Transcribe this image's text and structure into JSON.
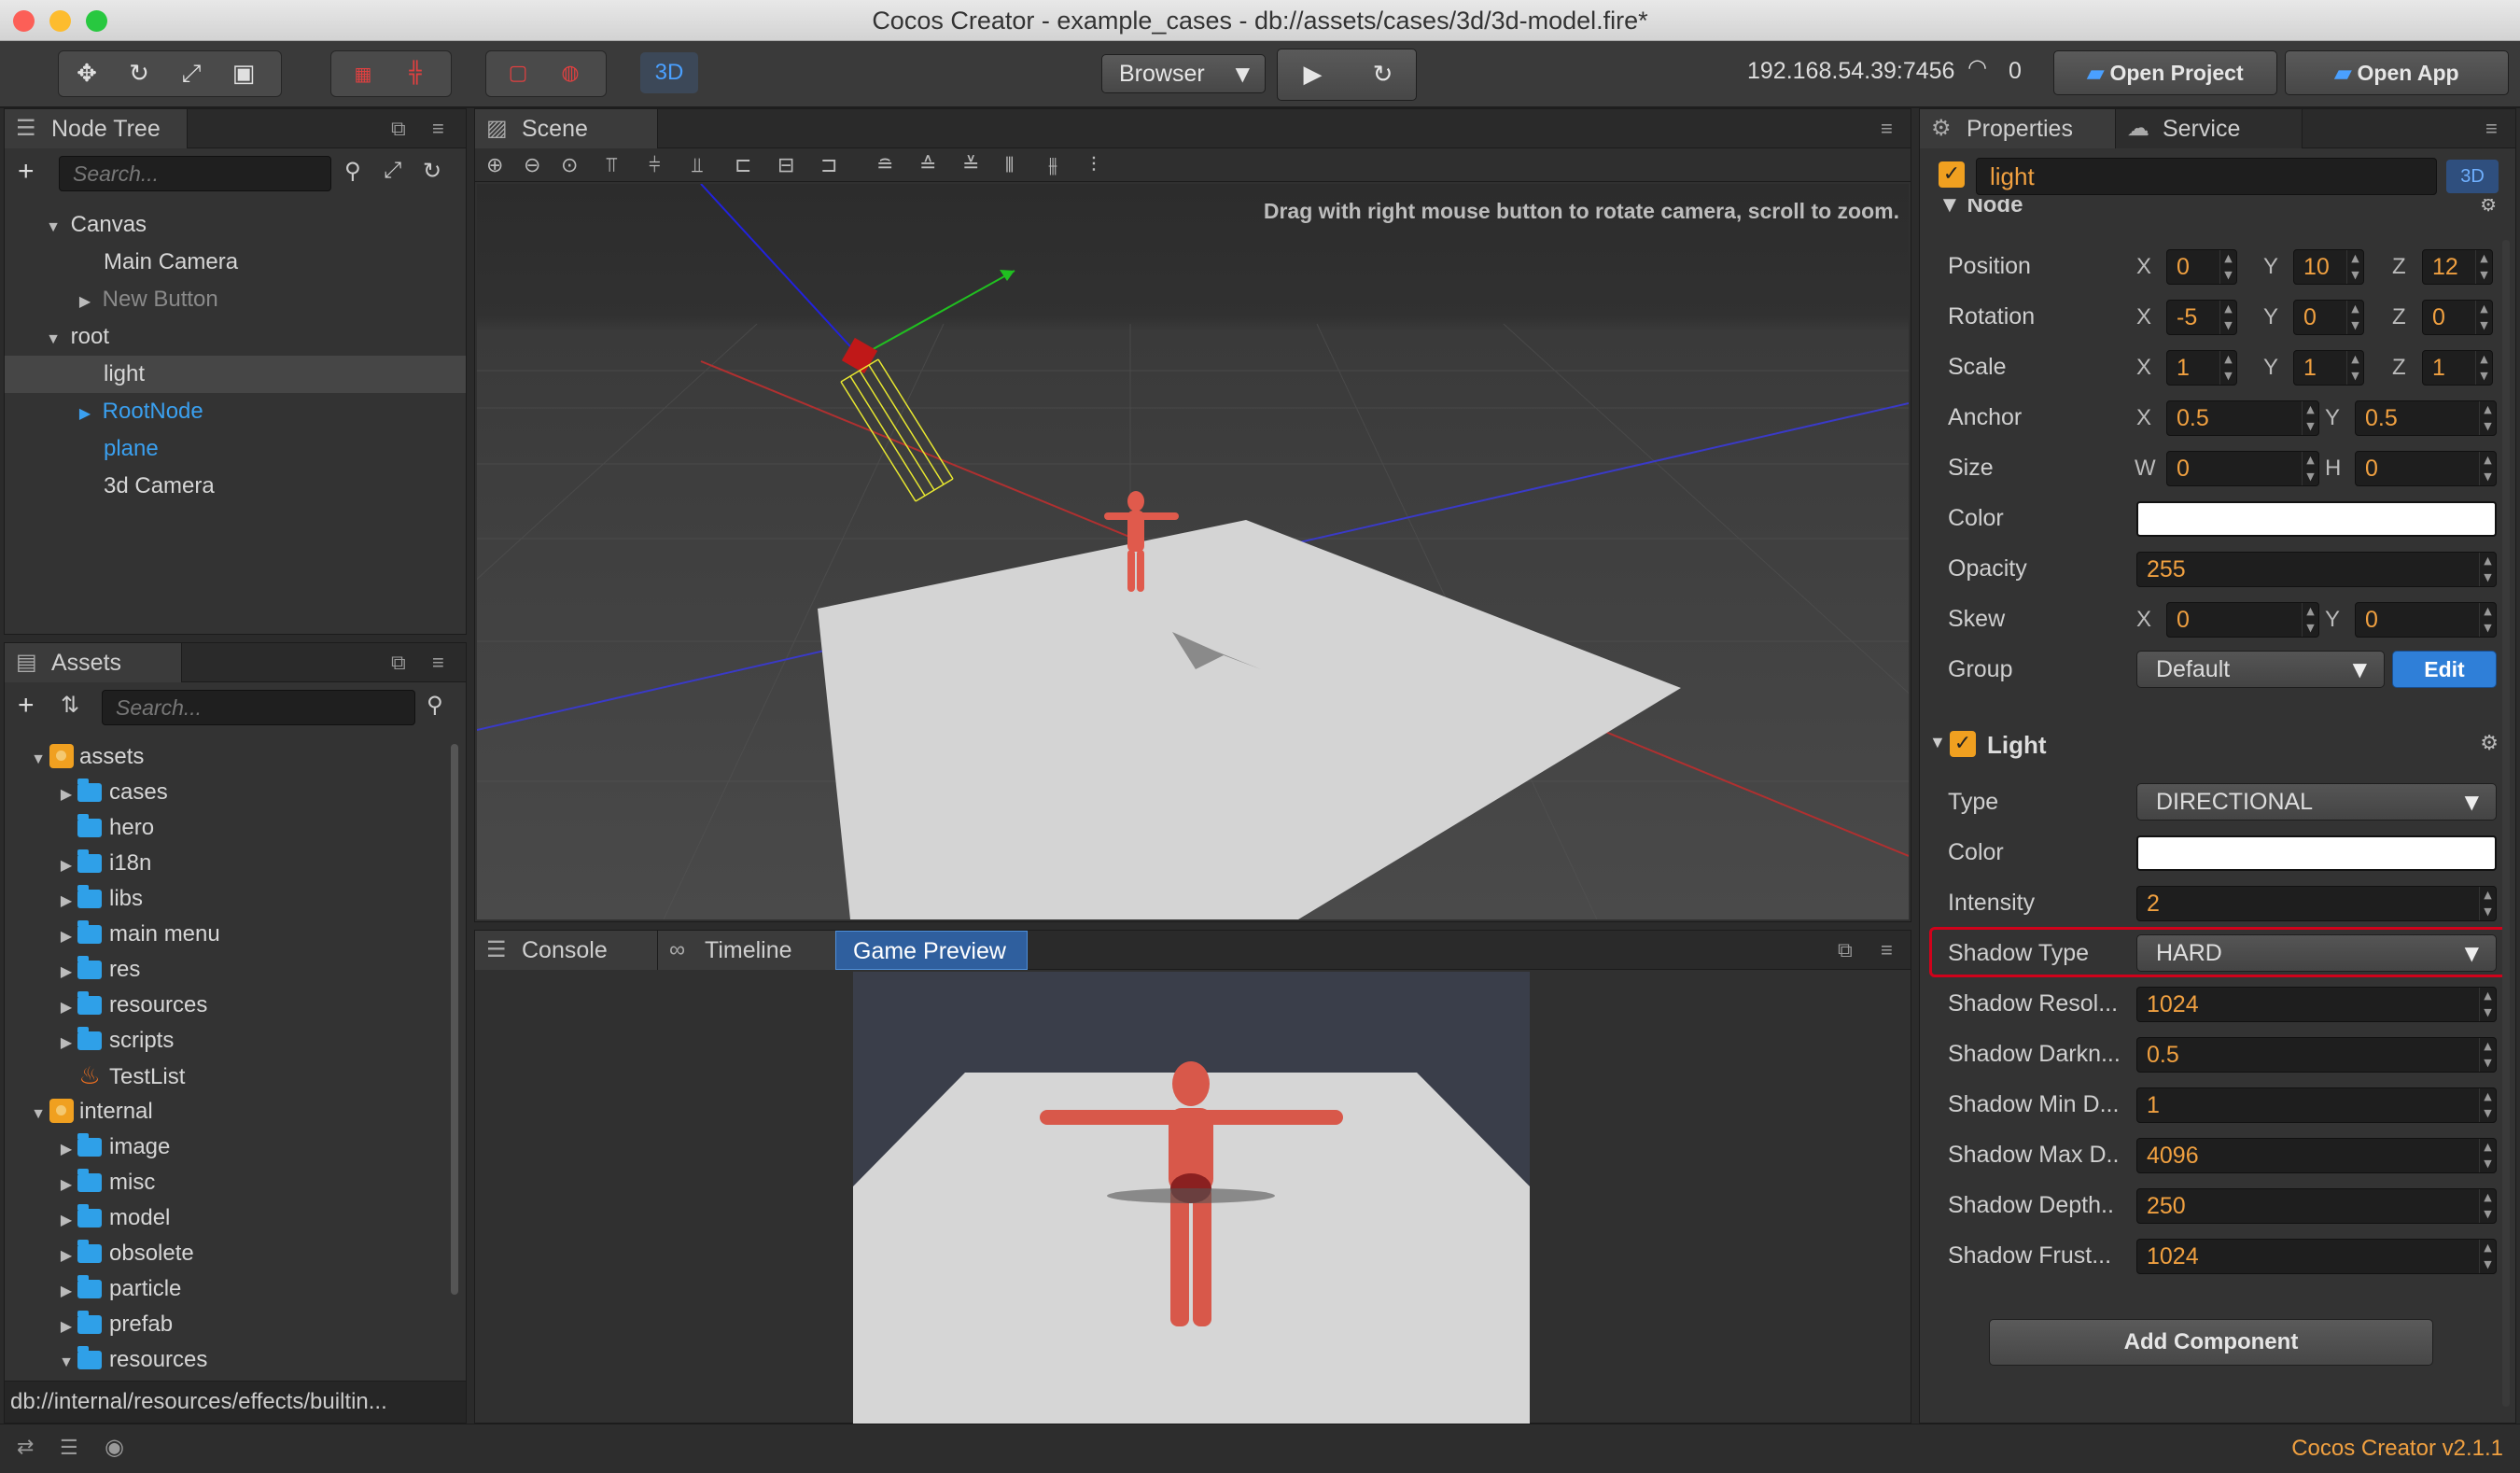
{
  "window": {
    "title": "Cocos Creator - example_cases - db://assets/cases/3d/3d-model.fire*"
  },
  "toolbar": {
    "mode_3d": "3D",
    "platform": "Browser",
    "ip": "192.168.54.39:7456",
    "connections": "0",
    "open_project": "Open Project",
    "open_app": "Open App"
  },
  "node_tree": {
    "tab": "Node Tree",
    "search_placeholder": "Search...",
    "items": [
      {
        "label": "Canvas"
      },
      {
        "label": "Main Camera"
      },
      {
        "label": "New Button"
      },
      {
        "label": "root"
      },
      {
        "label": "light"
      },
      {
        "label": "RootNode"
      },
      {
        "label": "plane"
      },
      {
        "label": "3d Camera"
      }
    ]
  },
  "assets": {
    "tab": "Assets",
    "search_placeholder": "Search...",
    "items": [
      {
        "label": "assets"
      },
      {
        "label": "cases"
      },
      {
        "label": "hero"
      },
      {
        "label": "i18n"
      },
      {
        "label": "libs"
      },
      {
        "label": "main menu"
      },
      {
        "label": "res"
      },
      {
        "label": "resources"
      },
      {
        "label": "scripts"
      },
      {
        "label": "TestList"
      },
      {
        "label": "internal"
      },
      {
        "label": "image"
      },
      {
        "label": "misc"
      },
      {
        "label": "model"
      },
      {
        "label": "obsolete"
      },
      {
        "label": "particle"
      },
      {
        "label": "prefab"
      },
      {
        "label": "resources"
      }
    ],
    "path": "db://internal/resources/effects/builtin..."
  },
  "scene": {
    "tab": "Scene",
    "hint": "Drag with right mouse button to rotate camera, scroll to zoom."
  },
  "bottom": {
    "tabs": [
      {
        "label": "Console"
      },
      {
        "label": "Timeline"
      },
      {
        "label": "Game Preview"
      }
    ]
  },
  "properties": {
    "tab": "Properties",
    "service_tab": "Service",
    "node_name": "light",
    "badge_3d": "3D",
    "section_node": "Node",
    "position": {
      "label": "Position",
      "x": "0",
      "y": "10",
      "z": "12"
    },
    "rotation": {
      "label": "Rotation",
      "x": "-5",
      "y": "0",
      "z": "0"
    },
    "scale": {
      "label": "Scale",
      "x": "1",
      "y": "1",
      "z": "1"
    },
    "anchor": {
      "label": "Anchor",
      "x": "0.5",
      "y": "0.5"
    },
    "size": {
      "label": "Size",
      "w": "0",
      "h": "0"
    },
    "color": {
      "label": "Color",
      "value": "#ffffff"
    },
    "opacity": {
      "label": "Opacity",
      "value": "255"
    },
    "skew": {
      "label": "Skew",
      "x": "0",
      "y": "0"
    },
    "group": {
      "label": "Group",
      "value": "Default",
      "edit": "Edit"
    },
    "axes": {
      "x": "X",
      "y": "Y",
      "z": "Z",
      "w": "W",
      "h": "H"
    },
    "light": {
      "section": "Light",
      "type": {
        "label": "Type",
        "value": "DIRECTIONAL"
      },
      "color": {
        "label": "Color",
        "value": "#ffffff"
      },
      "intensity": {
        "label": "Intensity",
        "value": "2"
      },
      "shadow_type": {
        "label": "Shadow Type",
        "value": "HARD"
      },
      "shadow_resolution": {
        "label": "Shadow Resol...",
        "value": "1024"
      },
      "shadow_darkness": {
        "label": "Shadow Darkn...",
        "value": "0.5"
      },
      "shadow_min_depth": {
        "label": "Shadow Min D...",
        "value": "1"
      },
      "shadow_max_depth": {
        "label": "Shadow Max D..",
        "value": "4096"
      },
      "shadow_depth_scale": {
        "label": "Shadow Depth..",
        "value": "250"
      },
      "shadow_frustum_size": {
        "label": "Shadow Frust...",
        "value": "1024"
      }
    },
    "add_component": "Add Component"
  },
  "status": {
    "version": "Cocos Creator v2.1.1"
  },
  "colors": {
    "accent": "#2f8fe8",
    "highlight": "#d0021b",
    "warning": "#f0a020"
  }
}
